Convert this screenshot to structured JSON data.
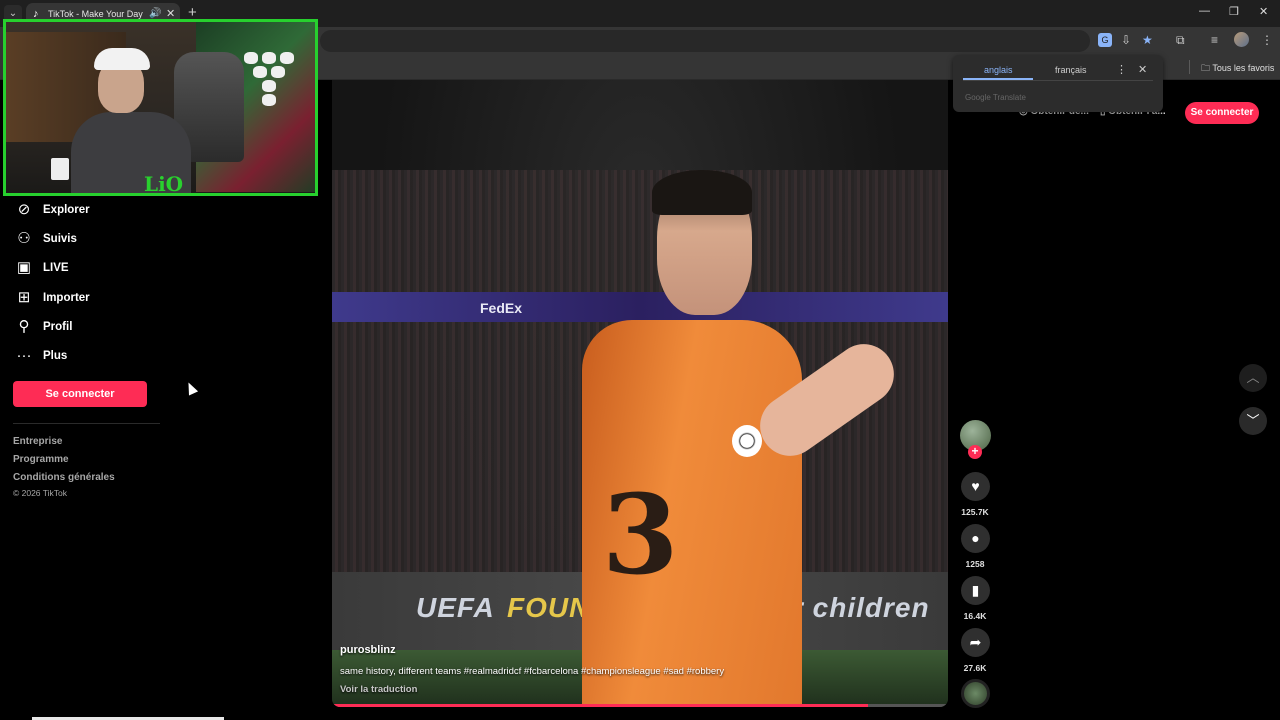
{
  "browser": {
    "tab_title": "TikTok - Make Your Day",
    "tab_favicon": "tiktok-icon",
    "new_tab": "+",
    "bookmark_folder": "Tous les favoris",
    "window_controls": [
      "minimize-icon",
      "restore-icon",
      "close-icon"
    ]
  },
  "translate_popup": {
    "source_lang": "anglais",
    "target_lang": "français",
    "brand": "Google Translate"
  },
  "header": {
    "link1": "Obtenir de...",
    "link2": "Obtenir l'a...",
    "login": "Se connecter"
  },
  "webcam": {
    "logo": "LiO"
  },
  "sidebar": {
    "items": [
      {
        "label": "Explorer",
        "icon": "compass-icon"
      },
      {
        "label": "Suivis",
        "icon": "following-icon"
      },
      {
        "label": "LIVE",
        "icon": "live-tv-icon"
      },
      {
        "label": "Importer",
        "icon": "upload-plus-icon"
      },
      {
        "label": "Profil",
        "icon": "profile-icon"
      },
      {
        "label": "Plus",
        "icon": "more-dots-icon"
      }
    ],
    "login_button": "Se connecter",
    "footer_links": [
      "Entreprise",
      "Programme",
      "Conditions générales"
    ],
    "copyright": "© 2026 TikTok"
  },
  "video": {
    "username": "purosblinz",
    "caption": "same history, different teams #realmadridcf #fcbarcelona #championsleague #sad #robbery",
    "translate_link": "Voir la traduction",
    "sponsor": "FedEx",
    "board_left": "UEFA",
    "board_mid": "FOUN",
    "board_right": "r children",
    "jersey_number": "3",
    "progress": 0.87
  },
  "actions": {
    "likes": "125.7K",
    "comments": "1258",
    "saves": "16.4K",
    "shares": "27.6K"
  },
  "colors": {
    "accent": "#fe2c55",
    "webcam_border": "#27d02e",
    "chrome_bg": "#353535"
  }
}
